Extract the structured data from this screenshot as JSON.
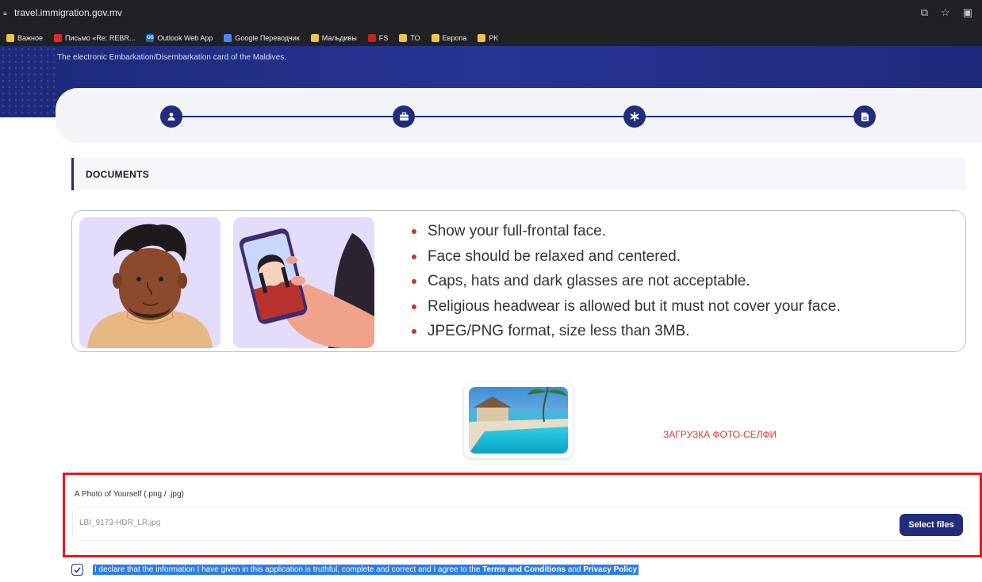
{
  "browser": {
    "url": "travel.immigration.gov.mv",
    "bookmarks": [
      {
        "label": "Важное",
        "icon": "folder-icon"
      },
      {
        "label": "Письмо «Re: REBR...",
        "icon": "mail-icon"
      },
      {
        "label": "Outlook Web App",
        "icon": "outlook-icon",
        "badge": "OS"
      },
      {
        "label": "Google Переводчик",
        "icon": "translate-icon"
      },
      {
        "label": "Мальдивы",
        "icon": "folder-icon"
      },
      {
        "label": "FS",
        "icon": "fs-icon"
      },
      {
        "label": "TO",
        "icon": "folder-icon"
      },
      {
        "label": "Европа",
        "icon": "folder-icon"
      },
      {
        "label": "PK",
        "icon": "folder-icon"
      }
    ]
  },
  "hero": {
    "subtitle": "The electronic Embarkation/Disembarkation card of the Maldives."
  },
  "stepper": {
    "steps": [
      {
        "icon": "user-icon"
      },
      {
        "icon": "briefcase-icon"
      },
      {
        "icon": "asterisk-icon"
      },
      {
        "icon": "document-icon"
      }
    ]
  },
  "section": {
    "title": "DOCUMENTS"
  },
  "guidelines": [
    "Show your full-frontal face.",
    "Face should be relaxed and centered.",
    "Caps, hats and dark glasses are not acceptable.",
    "Religious headwear is allowed but it must not cover your face.",
    "JPEG/PNG format, size less than 3MB."
  ],
  "annotation": "ЗАГРУЗКА ФОТО-СЕЛФИ",
  "upload": {
    "label": "A Photo of Yourself (.png / .jpg)",
    "filename": "LBI_9173-HDR_LR.jpg",
    "button": "Select files"
  },
  "declaration": {
    "text_start": "I declare that the information I have given in this application is truthful, complete and correct and I agree to the ",
    "terms": "Terms and Conditions",
    "and": " and ",
    "privacy": "Privacy Policy"
  },
  "colors": {
    "primary": "#1f2d7a",
    "highlight": "#e01b24",
    "selection": "#2f7de1"
  }
}
